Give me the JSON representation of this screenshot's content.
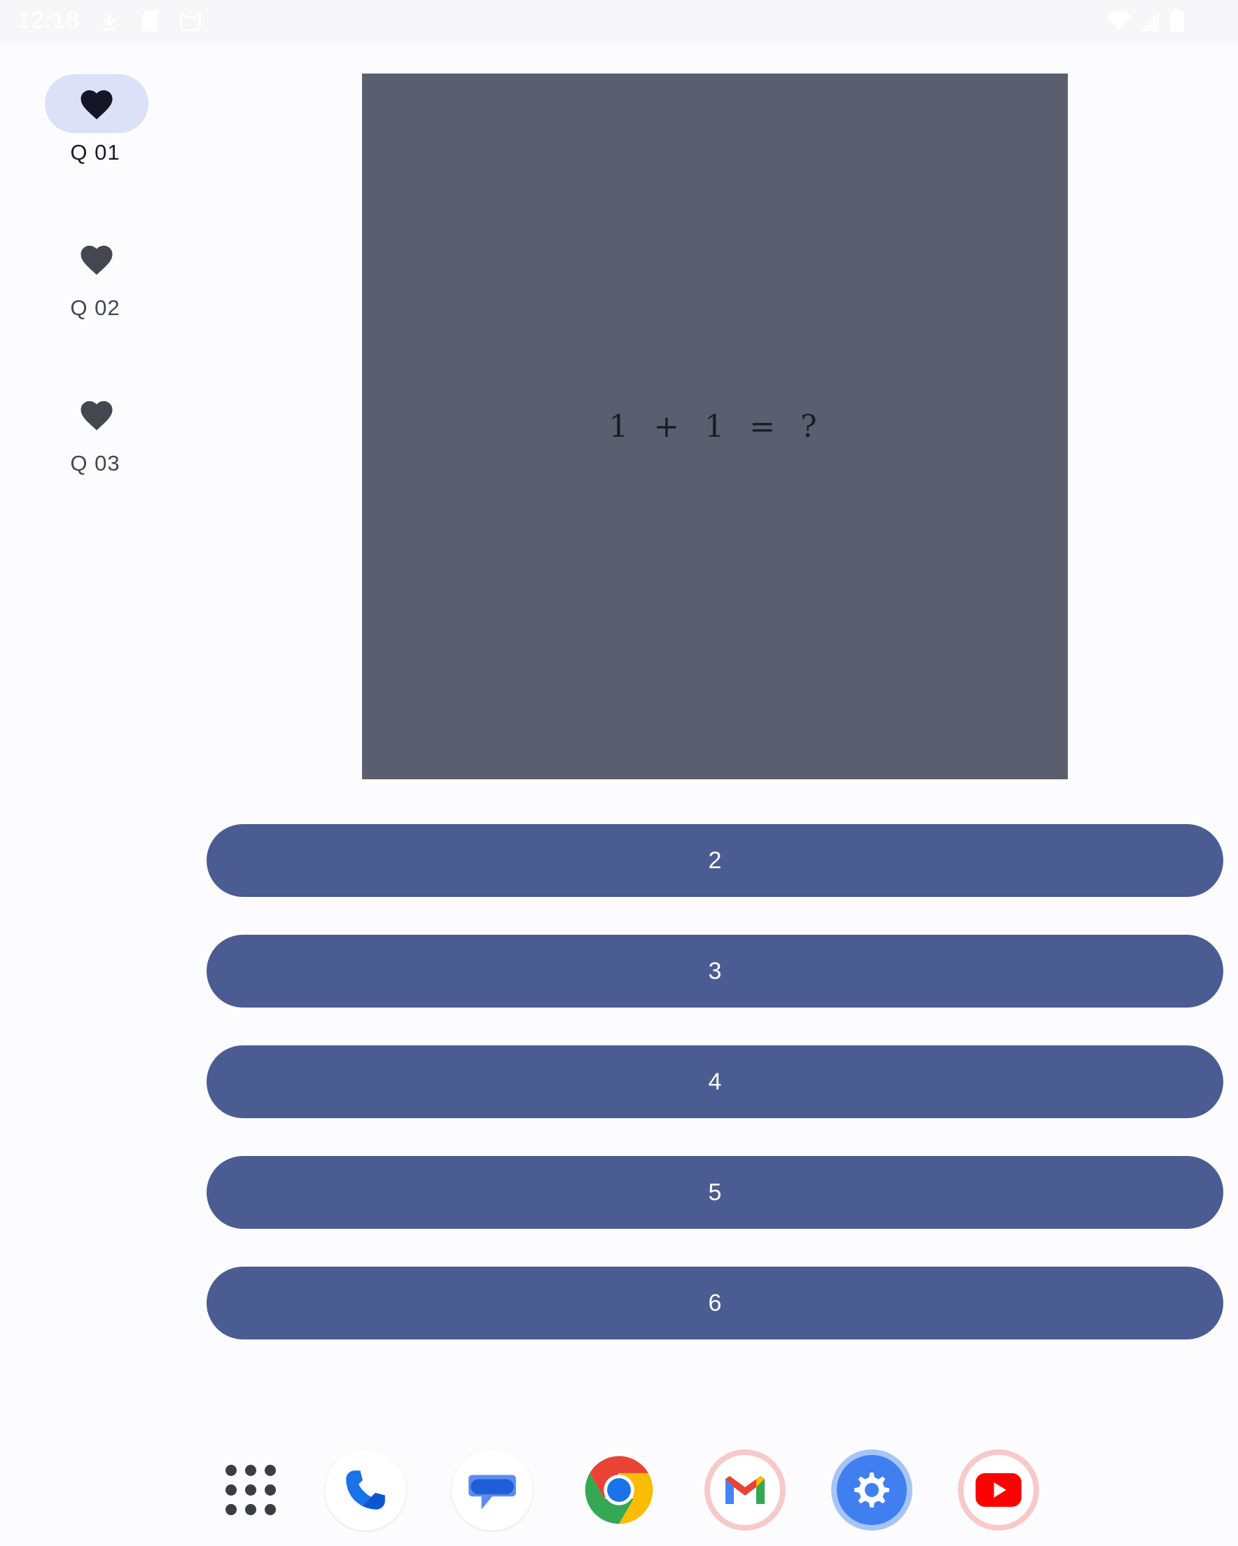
{
  "status_bar": {
    "time": "12:18",
    "icons": [
      "download-icon",
      "sd-card-icon",
      "cat-icon",
      "wifi-icon",
      "signal-icon",
      "battery-icon"
    ]
  },
  "nav": {
    "items": [
      {
        "label": "Q 01",
        "icon": "heart-icon",
        "selected": true
      },
      {
        "label": "Q 02",
        "icon": "heart-icon",
        "selected": false
      },
      {
        "label": "Q 03",
        "icon": "heart-icon",
        "selected": false
      }
    ]
  },
  "question": {
    "text": "1 + 1 = ?"
  },
  "answers": [
    {
      "label": "2"
    },
    {
      "label": "3"
    },
    {
      "label": "4"
    },
    {
      "label": "5"
    },
    {
      "label": "6"
    }
  ],
  "dock": {
    "apps": [
      "app-drawer",
      "phone",
      "messages",
      "chrome",
      "gmail",
      "settings",
      "youtube"
    ]
  },
  "colors": {
    "accent": "#4a5c92",
    "card": "#5a5f70",
    "nav_indicator": "#dde1f7"
  }
}
